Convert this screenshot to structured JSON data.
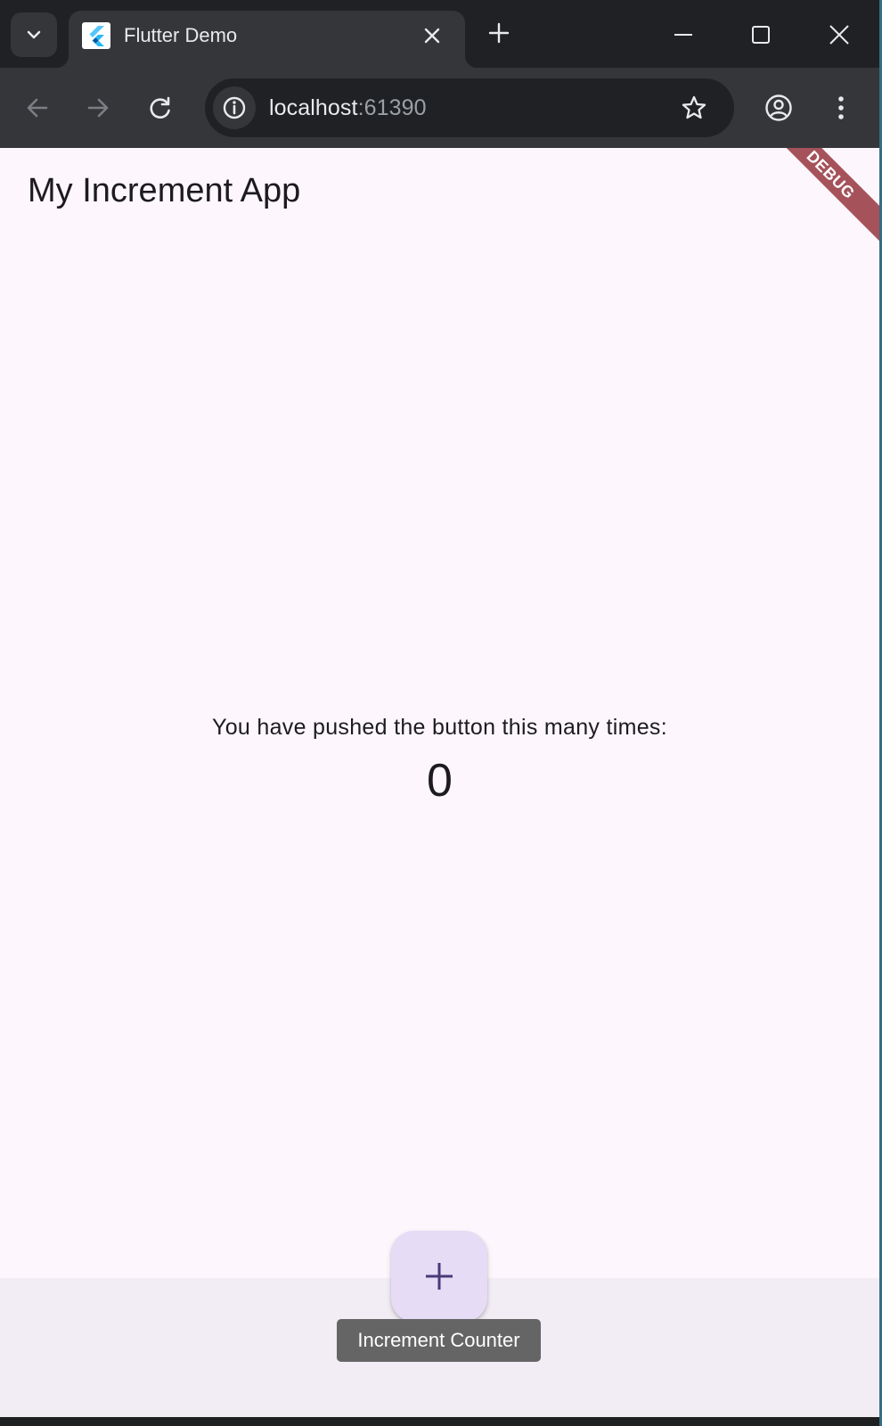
{
  "browser": {
    "tab": {
      "title": "Flutter Demo",
      "favicon": "flutter-logo-icon"
    },
    "address_bar": {
      "host": "localhost",
      "port": ":61390"
    },
    "icons": {
      "tab_search": "chevron-down-icon",
      "tab_close": "close-icon",
      "new_tab": "plus-icon",
      "minimize": "minimize-icon",
      "maximize": "maximize-icon",
      "close_window": "close-icon",
      "back": "arrow-left-icon",
      "forward": "arrow-right-icon",
      "reload": "reload-icon",
      "site_info": "info-icon",
      "bookmark": "star-icon",
      "profile": "account-circle-icon",
      "menu": "more-vert-icon"
    },
    "colors": {
      "frame": "#202124",
      "toolbar": "#35363a",
      "text": "#e8eaed"
    }
  },
  "app": {
    "title": "My Increment App",
    "debug_banner": "DEBUG",
    "message": "You have pushed the button this many times:",
    "counter": "0",
    "fab_icon": "add-icon",
    "fab_tooltip": "Increment Counter",
    "colors": {
      "background": "#fdf7fd",
      "bottom_bar": "#f2edf5",
      "fab": "#e6dcf5",
      "fab_icon": "#4a3a7a",
      "debug_banner": "#a6525b",
      "tooltip": "#656566"
    }
  }
}
